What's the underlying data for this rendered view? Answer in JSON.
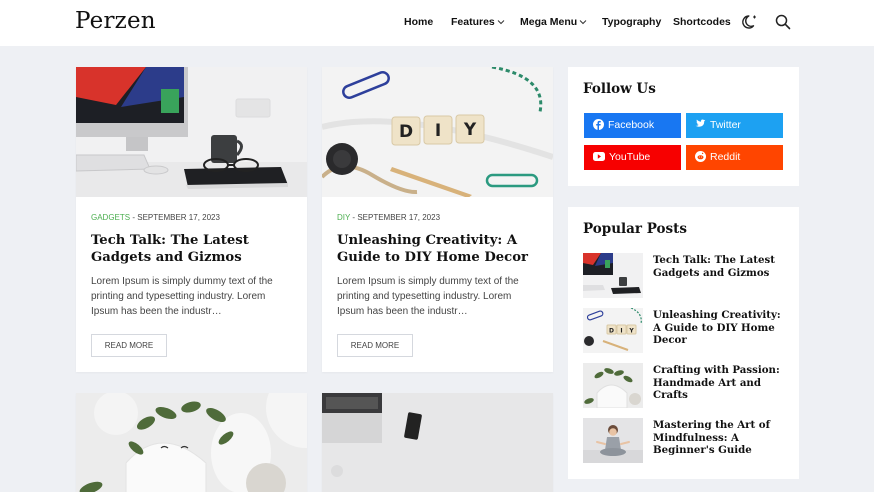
{
  "site": {
    "logo": "Perzen"
  },
  "nav": {
    "items": [
      {
        "label": "Home",
        "has_dropdown": false
      },
      {
        "label": "Features",
        "has_dropdown": true
      },
      {
        "label": "Mega Menu",
        "has_dropdown": true
      },
      {
        "label": "Typography",
        "has_dropdown": false
      },
      {
        "label": "Shortcodes",
        "has_dropdown": false
      }
    ],
    "icons": [
      "dark-mode-toggle-icon",
      "search-icon"
    ]
  },
  "posts": [
    {
      "category": "GADGETS",
      "separator": " - ",
      "date": "SEPTEMBER 17, 2023",
      "title": "Tech Talk: The Latest Gadgets and Gizmos",
      "excerpt": "Lorem Ipsum is simply dummy text of the printing and typesetting industry. Lorem Ipsum has been the industr…",
      "read_more": "READ MORE"
    },
    {
      "category": "DIY",
      "separator": " - ",
      "date": "SEPTEMBER 17, 2023",
      "title": "Unleashing Creativity: A Guide to DIY Home Decor",
      "excerpt": "Lorem Ipsum is simply dummy text of the printing and typesetting industry. Lorem Ipsum has been the industr…",
      "read_more": "READ MORE"
    }
  ],
  "images": {
    "diy_tiles": [
      "D",
      "I",
      "Y"
    ]
  },
  "follow_us": {
    "title": "Follow Us",
    "buttons": [
      {
        "label": "Facebook",
        "color": "#1877f2",
        "icon": "facebook-icon"
      },
      {
        "label": "Twitter",
        "color": "#1da1f2",
        "icon": "twitter-icon"
      },
      {
        "label": "YouTube",
        "color": "#f70000",
        "icon": "youtube-icon"
      },
      {
        "label": "Reddit",
        "color": "#ff4500",
        "icon": "reddit-icon"
      }
    ]
  },
  "popular_posts": {
    "title": "Popular Posts",
    "items": [
      {
        "title": "Tech Talk: The Latest Gadgets and Gizmos"
      },
      {
        "title": "Unleashing Creativity: A Guide to DIY Home Decor"
      },
      {
        "title": "Crafting with Passion: Handmade Art and Crafts"
      },
      {
        "title": "Mastering the Art of Mindfulness: A Beginner's Guide"
      }
    ]
  },
  "colors": {
    "background": "#eef0f4",
    "category_accent": "#4caf50",
    "text_dark": "#111111"
  }
}
